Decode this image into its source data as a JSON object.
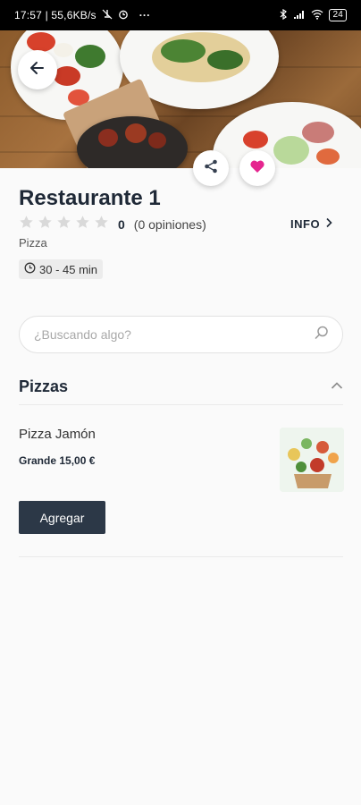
{
  "status_bar": {
    "time_network": "17:57 | 55,6KB/s",
    "more": "···",
    "battery": "24"
  },
  "hero": {
    "back_icon": "arrow-left-icon",
    "share_icon": "share-icon",
    "favorite_icon": "heart-icon",
    "favorite_color": "#e5258f"
  },
  "restaurant": {
    "name": "Restaurante 1",
    "rating_value": "0",
    "rating_opinions": "(0 opiniones)",
    "info_label": "INFO",
    "category": "Pizza",
    "delivery_time": "30 - 45 min"
  },
  "search": {
    "placeholder": "¿Buscando algo?",
    "icon": "search-icon"
  },
  "menu": {
    "section_title": "Pizzas",
    "items": [
      {
        "name": "Pizza Jamón",
        "price": "Grande 15,00 €",
        "add_label": "Agregar"
      }
    ]
  },
  "colors": {
    "primary_button": "#2c3847",
    "star_inactive": "#d9d9d9",
    "accent_pink": "#e5258f"
  }
}
